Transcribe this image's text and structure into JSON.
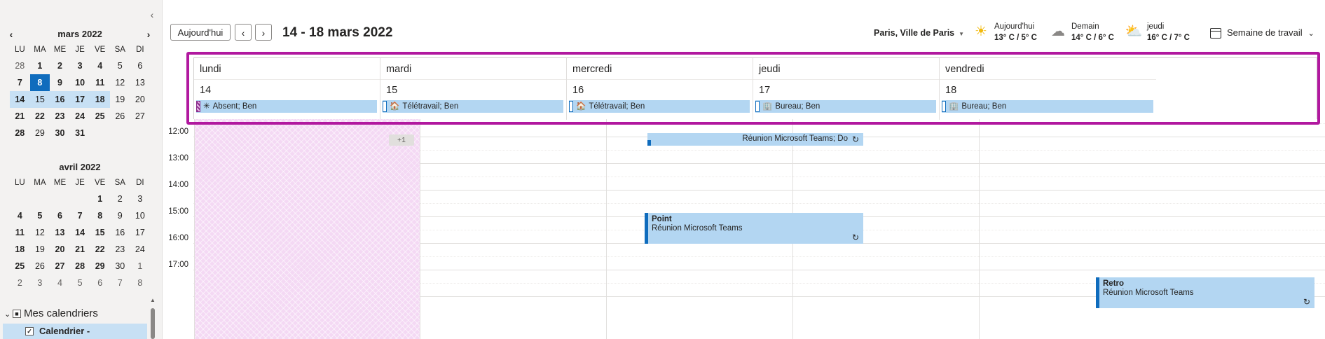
{
  "left_pane": {
    "collapse_icon": "chevron-left-icon",
    "calendars": [
      {
        "title": "mars 2022",
        "weekdays": [
          "LU",
          "MA",
          "ME",
          "JE",
          "VE",
          "SA",
          "DI"
        ],
        "days": [
          {
            "n": "28",
            "s": "o"
          },
          {
            "n": "1",
            "s": "b"
          },
          {
            "n": "2",
            "s": "b"
          },
          {
            "n": "3",
            "s": "b"
          },
          {
            "n": "4",
            "s": "b"
          },
          {
            "n": "5",
            "s": ""
          },
          {
            "n": "6",
            "s": ""
          },
          {
            "n": "7",
            "s": "b"
          },
          {
            "n": "8",
            "s": "today"
          },
          {
            "n": "9",
            "s": "b"
          },
          {
            "n": "10",
            "s": "b"
          },
          {
            "n": "11",
            "s": "b"
          },
          {
            "n": "12",
            "s": ""
          },
          {
            "n": "13",
            "s": ""
          },
          {
            "n": "14",
            "s": "b sel"
          },
          {
            "n": "15",
            "s": "sel"
          },
          {
            "n": "16",
            "s": "b sel"
          },
          {
            "n": "17",
            "s": "b sel"
          },
          {
            "n": "18",
            "s": "b sel"
          },
          {
            "n": "19",
            "s": ""
          },
          {
            "n": "20",
            "s": ""
          },
          {
            "n": "21",
            "s": "b"
          },
          {
            "n": "22",
            "s": "b"
          },
          {
            "n": "23",
            "s": "b"
          },
          {
            "n": "24",
            "s": "b"
          },
          {
            "n": "25",
            "s": "b"
          },
          {
            "n": "26",
            "s": ""
          },
          {
            "n": "27",
            "s": ""
          },
          {
            "n": "28",
            "s": "b"
          },
          {
            "n": "29",
            "s": ""
          },
          {
            "n": "30",
            "s": "b"
          },
          {
            "n": "31",
            "s": "b"
          }
        ]
      },
      {
        "title": "avril 2022",
        "weekdays": [
          "LU",
          "MA",
          "ME",
          "JE",
          "VE",
          "SA",
          "DI"
        ],
        "days": [
          {
            "n": "",
            "s": ""
          },
          {
            "n": "",
            "s": ""
          },
          {
            "n": "",
            "s": ""
          },
          {
            "n": "",
            "s": ""
          },
          {
            "n": "1",
            "s": "b"
          },
          {
            "n": "2",
            "s": ""
          },
          {
            "n": "3",
            "s": ""
          },
          {
            "n": "4",
            "s": "b"
          },
          {
            "n": "5",
            "s": "b"
          },
          {
            "n": "6",
            "s": "b"
          },
          {
            "n": "7",
            "s": "b"
          },
          {
            "n": "8",
            "s": "b"
          },
          {
            "n": "9",
            "s": ""
          },
          {
            "n": "10",
            "s": ""
          },
          {
            "n": "11",
            "s": "b"
          },
          {
            "n": "12",
            "s": ""
          },
          {
            "n": "13",
            "s": "b"
          },
          {
            "n": "14",
            "s": "b"
          },
          {
            "n": "15",
            "s": "b"
          },
          {
            "n": "16",
            "s": ""
          },
          {
            "n": "17",
            "s": ""
          },
          {
            "n": "18",
            "s": "b"
          },
          {
            "n": "19",
            "s": ""
          },
          {
            "n": "20",
            "s": "b"
          },
          {
            "n": "21",
            "s": "b"
          },
          {
            "n": "22",
            "s": "b"
          },
          {
            "n": "23",
            "s": ""
          },
          {
            "n": "24",
            "s": ""
          },
          {
            "n": "25",
            "s": "b"
          },
          {
            "n": "26",
            "s": ""
          },
          {
            "n": "27",
            "s": "b"
          },
          {
            "n": "28",
            "s": "b"
          },
          {
            "n": "29",
            "s": "b"
          },
          {
            "n": "30",
            "s": ""
          },
          {
            "n": "1",
            "s": "o"
          },
          {
            "n": "2",
            "s": "o"
          },
          {
            "n": "3",
            "s": "o"
          },
          {
            "n": "4",
            "s": "o"
          },
          {
            "n": "5",
            "s": "o"
          },
          {
            "n": "6",
            "s": "o"
          },
          {
            "n": "7",
            "s": "o"
          },
          {
            "n": "8",
            "s": "o"
          }
        ]
      }
    ],
    "section_title": "Mes calendriers",
    "calendar_item": "Calendrier -"
  },
  "toolbar": {
    "today_label": "Aujourd'hui",
    "prev_icon": "chevron-left-icon",
    "next_icon": "chevron-right-icon",
    "range_title": "14 - 18 mars 2022",
    "location": "Paris, Ville de Paris",
    "weather": [
      {
        "icon": "sun-icon",
        "label": "Aujourd'hui",
        "temp": "13° C / 5° C"
      },
      {
        "icon": "cloud-icon",
        "label": "Demain",
        "temp": "14° C / 6° C"
      },
      {
        "icon": "partly-sunny-icon",
        "label": "jeudi",
        "temp": "16° C / 7° C"
      }
    ],
    "view_label": "Semaine de travail"
  },
  "days": [
    {
      "name": "lundi",
      "num": "14",
      "allday": {
        "text": "Absent; Ben",
        "icon": "✳",
        "kind": "oof"
      }
    },
    {
      "name": "mardi",
      "num": "15",
      "allday": {
        "text": "Télétravail; Ben",
        "icon": "🏠",
        "kind": "busy"
      }
    },
    {
      "name": "mercredi",
      "num": "16",
      "allday": {
        "text": "Télétravail; Ben",
        "icon": "🏠",
        "kind": "busy"
      }
    },
    {
      "name": "jeudi",
      "num": "17",
      "allday": {
        "text": "Bureau; Ben",
        "icon": "🏢",
        "kind": "busy"
      }
    },
    {
      "name": "vendredi",
      "num": "18",
      "allday": {
        "text": "Bureau; Ben",
        "icon": "🏢",
        "kind": "busy"
      }
    }
  ],
  "grid": {
    "more_badge": "+1",
    "times": [
      "12:00",
      "13:00",
      "14:00",
      "15:00",
      "16:00",
      "17:00"
    ],
    "events": {
      "teams_top": {
        "text": "Réunion Microsoft Teams; Do",
        "icon": "↻"
      },
      "point": {
        "title": "Point",
        "subtitle": "Réunion Microsoft Teams",
        "icon": "↻"
      },
      "retro": {
        "title": "Retro",
        "subtitle": "Réunion Microsoft Teams",
        "icon": "↻"
      }
    }
  }
}
